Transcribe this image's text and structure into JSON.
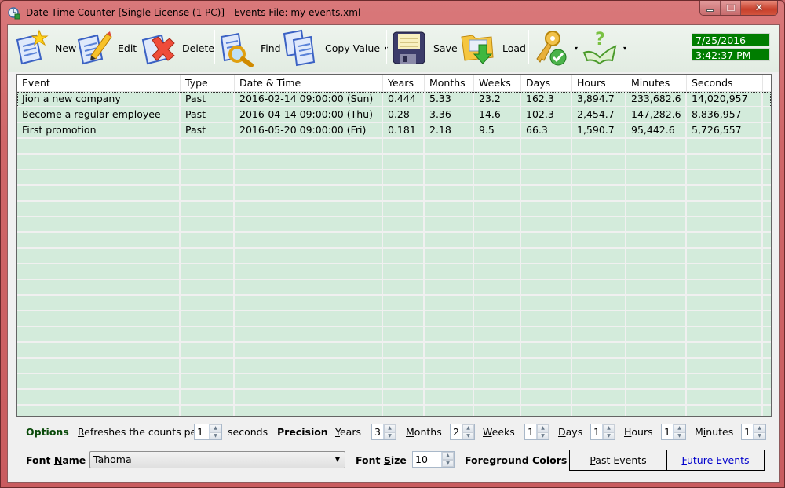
{
  "window": {
    "title": "Date Time Counter [Single License (1 PC)] - Events File: my events.xml",
    "controls": {
      "minimize": "minimize",
      "maximize": "maximize",
      "close": "close"
    }
  },
  "toolbar": {
    "new_label": "New",
    "edit_label": "Edit",
    "delete_label": "Delete",
    "find_label": "Find",
    "copy_value_label": "Copy Value",
    "save_label": "Save",
    "load_label": "Load",
    "dropdown_arrow": "▾"
  },
  "clock": {
    "date": "7/25/2016",
    "time": "3:42:37 PM"
  },
  "grid": {
    "columns": [
      "Event",
      "Type",
      "Date & Time",
      "Years",
      "Months",
      "Weeks",
      "Days",
      "Hours",
      "Minutes",
      "Seconds"
    ],
    "rows": [
      [
        "Jion a new company",
        "Past",
        "2016-02-14 09:00:00 (Sun)",
        "0.444",
        "5.33",
        "23.2",
        "162.3",
        "3,894.7",
        "233,682.6",
        "14,020,957"
      ],
      [
        "Become a regular employee",
        "Past",
        "2016-04-14 09:00:00 (Thu)",
        "0.28",
        "3.36",
        "14.6",
        "102.3",
        "2,454.7",
        "147,282.6",
        "8,836,957"
      ],
      [
        "First promotion",
        "Past",
        "2016-05-20 09:00:00 (Fri)",
        "0.181",
        "2.18",
        "9.5",
        "66.3",
        "1,590.7",
        "95,442.6",
        "5,726,557"
      ]
    ],
    "selected_row": 0,
    "row_background": "#d3ebdb"
  },
  "options": {
    "title": "Options",
    "refresh_label_pre": "R",
    "refresh_label_rest": "efreshes the counts per",
    "refresh_value": "1",
    "refresh_unit": "seconds",
    "precision_label": "Precision",
    "years_u": "Y",
    "years_rest": "ears",
    "years_value": "3",
    "months_u": "M",
    "months_rest": "onths",
    "months_value": "2",
    "weeks_u": "W",
    "weeks_rest": "eeks",
    "weeks_value": "1",
    "days_u": "D",
    "days_rest": "ays",
    "days_value": "1",
    "hours_u": "H",
    "hours_rest": "ours",
    "hours_value": "1",
    "minutes_pre": "M",
    "minutes_u": "i",
    "minutes_rest": "nutes",
    "minutes_value": "1",
    "font_name_pre": "Font ",
    "font_name_u": "N",
    "font_name_rest": "ame",
    "font_name_value": "Tahoma",
    "font_size_pre": "Font ",
    "font_size_u": "S",
    "font_size_rest": "ize",
    "font_size_value": "10",
    "fg_colors_label": "Foreground Colors",
    "past_u": "P",
    "past_rest": "ast Events",
    "future_u": "F",
    "future_rest": "uture Events"
  },
  "colors": {
    "clock_bg": "#007d00",
    "options_title": "#0a4a0a",
    "future_events": "#0000cc",
    "titlebar": "#cf6668"
  }
}
